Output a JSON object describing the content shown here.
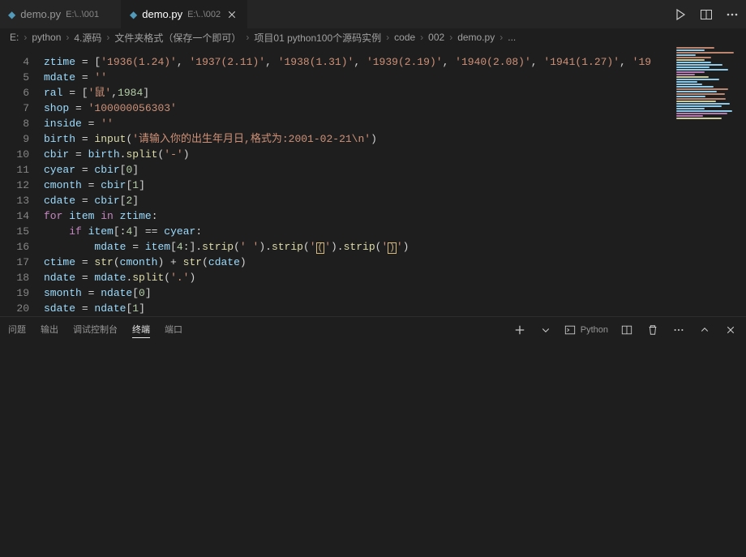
{
  "tabs": [
    {
      "icon": "python",
      "name": "demo.py",
      "desc": "E:\\..\\001"
    },
    {
      "icon": "python",
      "name": "demo.py",
      "desc": "E:\\..\\002",
      "active": true
    }
  ],
  "breadcrumb": {
    "root": "E:",
    "items": [
      "python",
      "4.源码",
      "文件夹格式（保存一个即可）",
      "项目01 python100个源码实例",
      "code",
      "002",
      "demo.py",
      "..."
    ]
  },
  "gutter_start": 4,
  "code_lines": [
    [
      [
        "var",
        "ztime"
      ],
      [
        "op",
        " = ["
      ],
      [
        "str",
        "'1936(1.24)'"
      ],
      [
        "op",
        ", "
      ],
      [
        "str",
        "'1937(2.11)'"
      ],
      [
        "op",
        ", "
      ],
      [
        "str",
        "'1938(1.31)'"
      ],
      [
        "op",
        ", "
      ],
      [
        "str",
        "'1939(2.19)'"
      ],
      [
        "op",
        ", "
      ],
      [
        "str",
        "'1940(2.08)'"
      ],
      [
        "op",
        ", "
      ],
      [
        "str",
        "'1941(1.27)'"
      ],
      [
        "op",
        ", "
      ],
      [
        "str",
        "'19"
      ]
    ],
    [
      [
        "var",
        "mdate"
      ],
      [
        "op",
        " = "
      ],
      [
        "str",
        "''"
      ]
    ],
    [
      [
        "var",
        "ral"
      ],
      [
        "op",
        " = ["
      ],
      [
        "str",
        "'鼠'"
      ],
      [
        "op",
        ","
      ],
      [
        "num",
        "1984"
      ],
      [
        "op",
        "]"
      ]
    ],
    [
      [
        "var",
        "shop"
      ],
      [
        "op",
        " = "
      ],
      [
        "str",
        "'100000056303'"
      ]
    ],
    [
      [
        "var",
        "inside"
      ],
      [
        "op",
        " = "
      ],
      [
        "str",
        "''"
      ]
    ],
    [
      [
        "var",
        "birth"
      ],
      [
        "op",
        " = "
      ],
      [
        "fn",
        "input"
      ],
      [
        "op",
        "("
      ],
      [
        "str",
        "'请输入你的出生年月日,格式为:2001-02-21\\n'"
      ],
      [
        "op",
        ")"
      ]
    ],
    [
      [
        "var",
        "cbir"
      ],
      [
        "op",
        " = "
      ],
      [
        "var",
        "birth"
      ],
      [
        "op",
        "."
      ],
      [
        "fn",
        "split"
      ],
      [
        "op",
        "("
      ],
      [
        "str",
        "'-'"
      ],
      [
        "op",
        ")"
      ]
    ],
    [
      [
        "var",
        "cyear"
      ],
      [
        "op",
        " = "
      ],
      [
        "var",
        "cbir"
      ],
      [
        "op",
        "["
      ],
      [
        "num",
        "0"
      ],
      [
        "op",
        "]"
      ]
    ],
    [
      [
        "var",
        "cmonth"
      ],
      [
        "op",
        " = "
      ],
      [
        "var",
        "cbir"
      ],
      [
        "op",
        "["
      ],
      [
        "num",
        "1"
      ],
      [
        "op",
        "]"
      ]
    ],
    [
      [
        "var",
        "cdate"
      ],
      [
        "op",
        " = "
      ],
      [
        "var",
        "cbir"
      ],
      [
        "op",
        "["
      ],
      [
        "num",
        "2"
      ],
      [
        "op",
        "]"
      ]
    ],
    [
      [
        "kw",
        "for"
      ],
      [
        "op",
        " "
      ],
      [
        "var",
        "item"
      ],
      [
        "op",
        " "
      ],
      [
        "kw",
        "in"
      ],
      [
        "op",
        " "
      ],
      [
        "var",
        "ztime"
      ],
      [
        "op",
        ":"
      ]
    ],
    [
      [
        "op",
        "    "
      ],
      [
        "kw",
        "if"
      ],
      [
        "op",
        " "
      ],
      [
        "var",
        "item"
      ],
      [
        "op",
        "[:"
      ],
      [
        "num",
        "4"
      ],
      [
        "op",
        "] == "
      ],
      [
        "var",
        "cyear"
      ],
      [
        "op",
        ":"
      ]
    ],
    [
      [
        "op",
        "        "
      ],
      [
        "var",
        "mdate"
      ],
      [
        "op",
        " = "
      ],
      [
        "var",
        "item"
      ],
      [
        "op",
        "["
      ],
      [
        "num",
        "4"
      ],
      [
        "op",
        ":]."
      ],
      [
        "fn",
        "strip"
      ],
      [
        "op",
        "("
      ],
      [
        "str",
        "' '"
      ],
      [
        "op",
        ")."
      ],
      [
        "fn",
        "strip"
      ],
      [
        "op",
        "("
      ],
      [
        "str",
        "'"
      ],
      [
        "hidden",
        "("
      ],
      [
        "str",
        "'"
      ],
      [
        "op",
        ")."
      ],
      [
        "fn",
        "strip"
      ],
      [
        "op",
        "("
      ],
      [
        "str",
        "'"
      ],
      [
        "hidden",
        ")"
      ],
      [
        "str",
        "'"
      ],
      [
        "op",
        ")"
      ]
    ],
    [
      [
        "var",
        "ctime"
      ],
      [
        "op",
        " = "
      ],
      [
        "fn",
        "str"
      ],
      [
        "op",
        "("
      ],
      [
        "var",
        "cmonth"
      ],
      [
        "op",
        ") + "
      ],
      [
        "fn",
        "str"
      ],
      [
        "op",
        "("
      ],
      [
        "var",
        "cdate"
      ],
      [
        "op",
        ")"
      ]
    ],
    [
      [
        "var",
        "ndate"
      ],
      [
        "op",
        " = "
      ],
      [
        "var",
        "mdate"
      ],
      [
        "op",
        "."
      ],
      [
        "fn",
        "split"
      ],
      [
        "op",
        "("
      ],
      [
        "str",
        "'.'"
      ],
      [
        "op",
        ")"
      ]
    ],
    [
      [
        "var",
        "smonth"
      ],
      [
        "op",
        " = "
      ],
      [
        "var",
        "ndate"
      ],
      [
        "op",
        "["
      ],
      [
        "num",
        "0"
      ],
      [
        "op",
        "]"
      ]
    ],
    [
      [
        "var",
        "sdate"
      ],
      [
        "op",
        " = "
      ],
      [
        "var",
        "ndate"
      ],
      [
        "op",
        "["
      ],
      [
        "num",
        "1"
      ],
      [
        "op",
        "]"
      ]
    ]
  ],
  "panel": {
    "tabs": [
      "问题",
      "输出",
      "调试控制台",
      "终端",
      "端口"
    ],
    "active_index": 3,
    "interpreter_label": "Python"
  }
}
